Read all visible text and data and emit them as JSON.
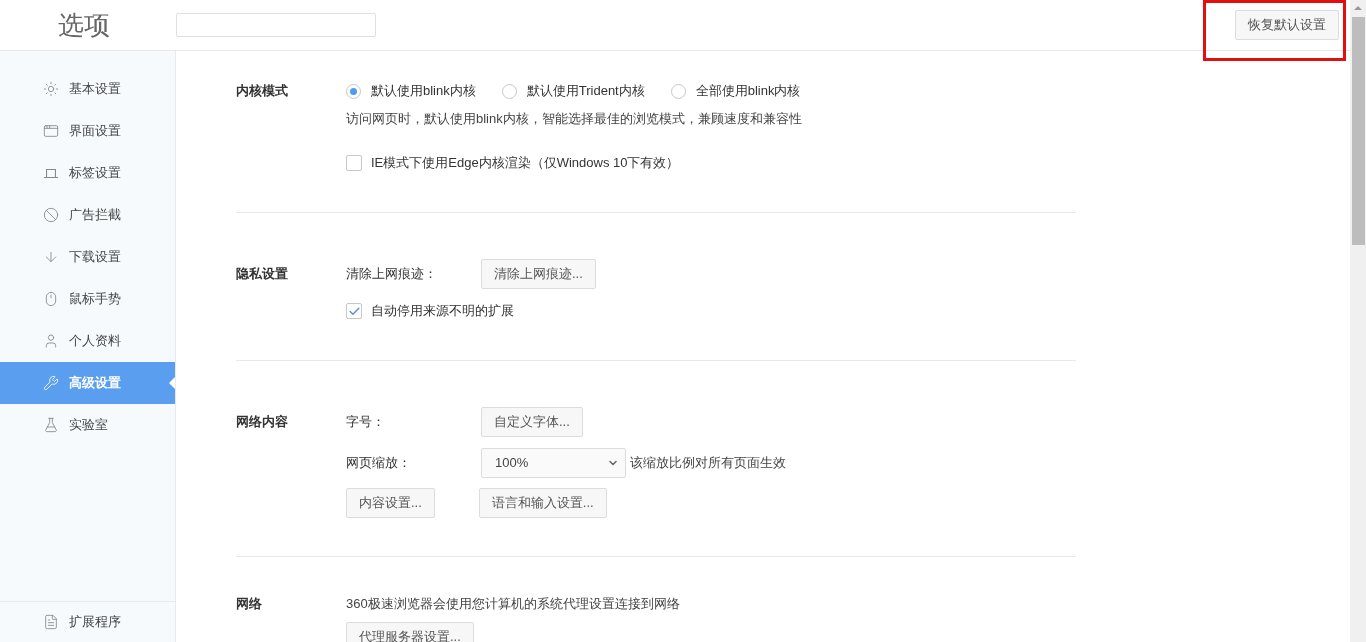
{
  "header": {
    "title": "选项",
    "restore_button": "恢复默认设置"
  },
  "sidebar": {
    "items": [
      {
        "label": "基本设置",
        "selected": false
      },
      {
        "label": "界面设置",
        "selected": false
      },
      {
        "label": "标签设置",
        "selected": false
      },
      {
        "label": "广告拦截",
        "selected": false
      },
      {
        "label": "下载设置",
        "selected": false
      },
      {
        "label": "鼠标手势",
        "selected": false
      },
      {
        "label": "个人资料",
        "selected": false
      },
      {
        "label": "高级设置",
        "selected": true
      },
      {
        "label": "实验室",
        "selected": false
      }
    ],
    "footer_item": "扩展程序"
  },
  "sections": [
    {
      "title": "内核模式",
      "rows": [
        {
          "kind": "radios",
          "options": [
            {
              "label": "默认使用blink内核",
              "selected": true
            },
            {
              "label": "默认使用Trident内核",
              "selected": false
            },
            {
              "label": "全部使用blink内核",
              "selected": false
            }
          ]
        },
        {
          "kind": "text",
          "text": "访问网页时，默认使用blink内核，智能选择最佳的浏览模式，兼顾速度和兼容性"
        },
        {
          "kind": "checkbox",
          "label": "IE模式下使用Edge内核渲染（仅Windows 10下有效）",
          "checked": false
        }
      ]
    },
    {
      "title": "隐私设置",
      "rows": [
        {
          "kind": "labeled-button",
          "label": "清除上网痕迹：",
          "button": "清除上网痕迹..."
        },
        {
          "kind": "checkbox",
          "label": "自动停用来源不明的扩展",
          "checked": true
        }
      ]
    },
    {
      "title": "网络内容",
      "rows": [
        {
          "kind": "labeled-button",
          "label": "字号：",
          "button": "自定义字体..."
        },
        {
          "kind": "labeled-select",
          "label": "网页缩放：",
          "value": "100%",
          "note": "该缩放比例对所有页面生效"
        },
        {
          "kind": "buttons",
          "buttons": [
            "内容设置...",
            "语言和输入设置..."
          ]
        }
      ]
    },
    {
      "title": "网络",
      "rows": [
        {
          "kind": "text",
          "text": "360极速浏览器会使用您计算机的系统代理设置连接到网络"
        },
        {
          "kind": "buttons",
          "buttons": [
            "代理服务器设置..."
          ]
        }
      ]
    }
  ]
}
